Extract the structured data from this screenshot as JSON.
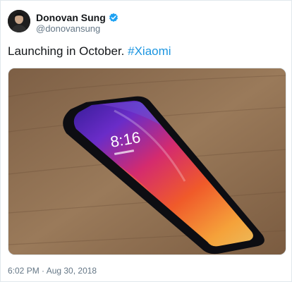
{
  "author": {
    "display_name": "Donovan Sung",
    "handle": "@donovansung",
    "verified_icon": "verified-badge-icon"
  },
  "tweet": {
    "text_before": "Launching in October. ",
    "hashtag": "#Xiaomi",
    "timestamp": "6:02 PM · Aug 30, 2018"
  },
  "media": {
    "phone_clock": "8:16"
  },
  "colors": {
    "hashtag": "#1b95e0",
    "verified": "#1da1f2",
    "secondary_text": "#657786"
  }
}
